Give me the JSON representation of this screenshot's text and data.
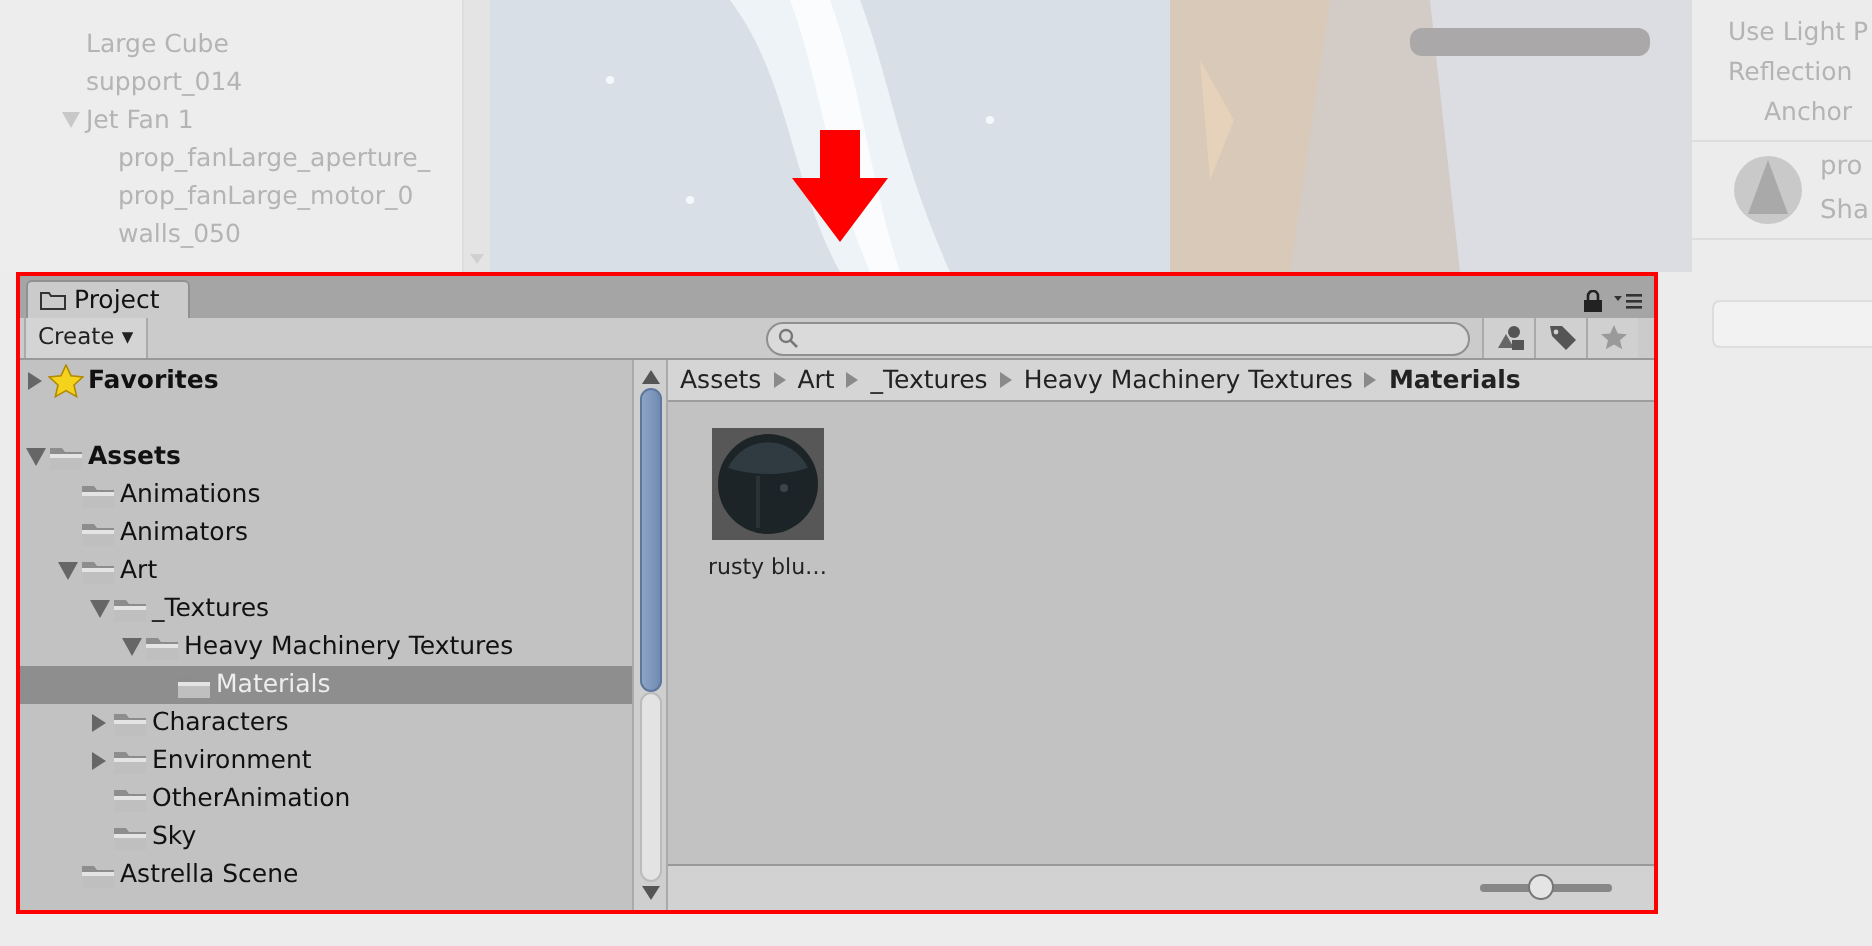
{
  "hierarchy": {
    "items": [
      {
        "label": "Large Cube"
      },
      {
        "label": "support_014"
      },
      {
        "label": "Jet Fan 1",
        "expanded": true,
        "children": [
          {
            "label": "prop_fanLarge_aperture_"
          },
          {
            "label": "prop_fanLarge_motor_0"
          },
          {
            "label": "walls_050"
          }
        ]
      }
    ]
  },
  "inspector": {
    "fields": [
      "Use Light P",
      "Reflection",
      "Anchor"
    ],
    "asset_name": "pro",
    "asset_shader": "Sha"
  },
  "project_panel": {
    "tab": {
      "label": "Project",
      "selected": true
    },
    "create_button": "Create ▾",
    "tree": [
      {
        "label": "Favorites",
        "kind": "favorites",
        "expanded": false,
        "selected": false
      },
      {
        "label": "Assets",
        "kind": "root",
        "expanded": true,
        "selected": false,
        "children": [
          {
            "label": "Animations",
            "kind": "folder",
            "selected": false
          },
          {
            "label": "Animators",
            "kind": "folder",
            "selected": false
          },
          {
            "label": "Art",
            "kind": "folder",
            "expanded": true,
            "selected": false,
            "children": [
              {
                "label": "_Textures",
                "kind": "folder",
                "expanded": true,
                "selected": false,
                "children": [
                  {
                    "label": "Heavy Machinery Textures",
                    "kind": "folder",
                    "expanded": true,
                    "selected": false,
                    "children": [
                      {
                        "label": "Materials",
                        "kind": "folder",
                        "selected": true
                      }
                    ]
                  }
                ]
              },
              {
                "label": "Characters",
                "kind": "folder",
                "expanded": false,
                "selected": false
              },
              {
                "label": "Environment",
                "kind": "folder",
                "expanded": false,
                "selected": false
              },
              {
                "label": "OtherAnimation",
                "kind": "folder",
                "selected": false
              },
              {
                "label": "Sky",
                "kind": "folder",
                "selected": false
              }
            ]
          },
          {
            "label": "Astrella Scene",
            "kind": "folder",
            "selected": false
          }
        ]
      }
    ],
    "breadcrumb": [
      "Assets",
      "Art",
      "_Textures",
      "Heavy Machinery Textures",
      "Materials"
    ],
    "assets": [
      {
        "label": "rusty blu…"
      }
    ],
    "zoom_slider": {
      "level": 0.45
    }
  }
}
